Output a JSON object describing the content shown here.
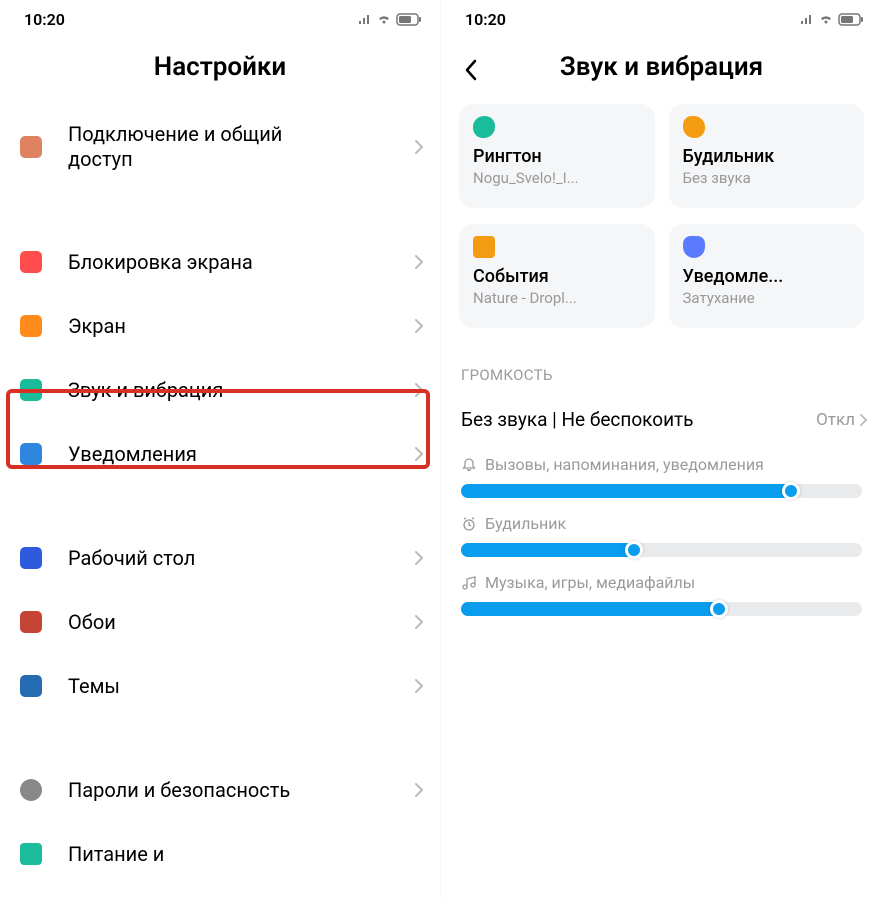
{
  "status": {
    "time": "10:20"
  },
  "left": {
    "title": "Настройки",
    "items": [
      {
        "label": "Подключение и общий\nдоступ"
      },
      {
        "label": "Блокировка экрана"
      },
      {
        "label": "Экран"
      },
      {
        "label": "Звук и вибрация"
      },
      {
        "label": "Уведомления"
      },
      {
        "label": "Рабочий стол"
      },
      {
        "label": "Обои"
      },
      {
        "label": "Темы"
      },
      {
        "label": "Пароли и безопасность"
      },
      {
        "label": "Питание и"
      }
    ]
  },
  "right": {
    "title": "Звук и вибрация",
    "cards": [
      {
        "title": "Рингтон",
        "sub": "Nogu_Svelo!_I..."
      },
      {
        "title": "Будильник",
        "sub": "Без звука"
      },
      {
        "title": "События",
        "sub": "Nature - Dropl..."
      },
      {
        "title": "Уведомле...",
        "sub": "Затухание"
      }
    ],
    "section_volume": "ГРОМКОСТЬ",
    "dnd": {
      "label": "Без звука | Не беспокоить",
      "value": "Откл"
    },
    "sliders": [
      {
        "label": "Вызовы, напоминания, уведомления",
        "percent": 84
      },
      {
        "label": "Будильник",
        "percent": 45
      },
      {
        "label": "Музыка, игры, медиафайлы",
        "percent": 66
      }
    ]
  }
}
